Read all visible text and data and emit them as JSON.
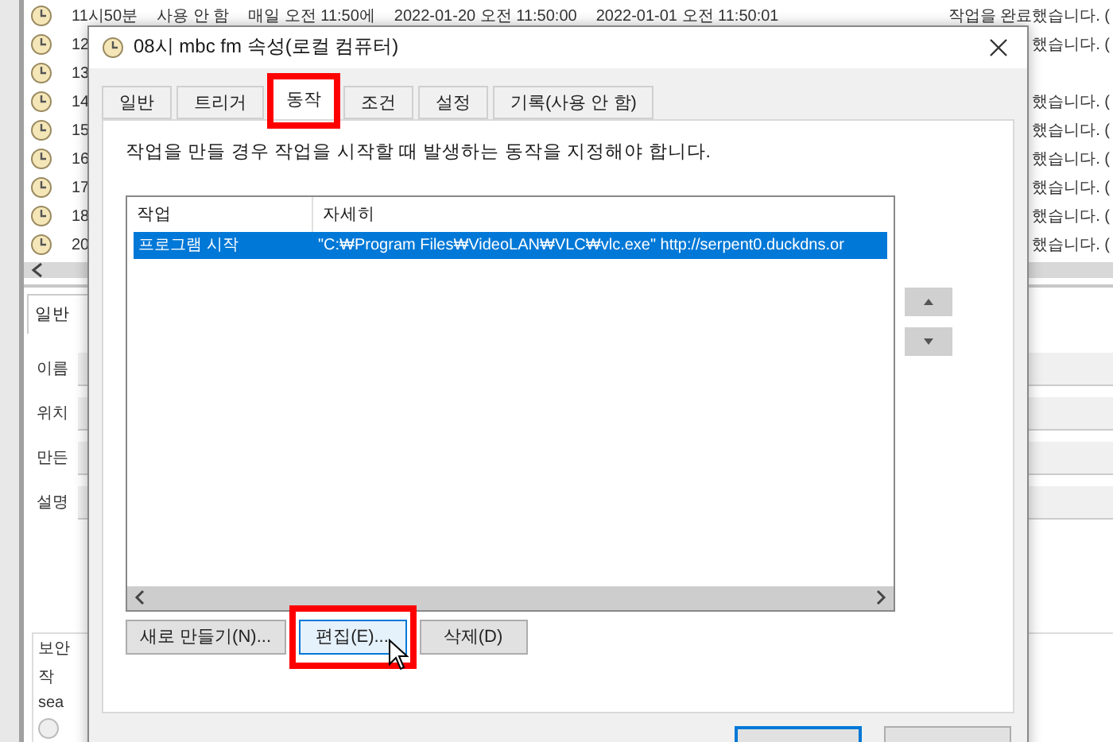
{
  "background": {
    "task_rows": [
      {
        "name": "11시50분",
        "status": "사용 안 함",
        "trigger": "매일 오전 11:50에",
        "next_run": "2022-01-20 오전 11:50:00",
        "last_run": "2022-01-01 오전 11:50:01",
        "result": "작업을 완료했습니다. ("
      },
      {
        "name": "12",
        "result": "했습니다. ("
      },
      {
        "name": "13"
      },
      {
        "name": "14",
        "result": "했습니다. ("
      },
      {
        "name": "15",
        "result": "했습니다. ("
      },
      {
        "name": "16",
        "result": "했습니다. ("
      },
      {
        "name": "17",
        "result": "했습니다. ("
      },
      {
        "name": "18",
        "result": "했습니다. ("
      },
      {
        "name": "20",
        "result": "했습니다. ("
      }
    ],
    "detail_tab": "일반",
    "fields": [
      "이름",
      "위치",
      "만든",
      "설명"
    ],
    "security_group": "보안",
    "security_label": "작",
    "account_value": "sea",
    "radio_checked": false
  },
  "dialog": {
    "title": "08시 mbc fm 속성(로컬 컴퓨터)",
    "tabs": [
      {
        "label": "일반",
        "selected": false,
        "highlighted": false
      },
      {
        "label": "트리거",
        "selected": false,
        "highlighted": false
      },
      {
        "label": "동작",
        "selected": true,
        "highlighted": true
      },
      {
        "label": "조건",
        "selected": false,
        "highlighted": false
      },
      {
        "label": "설정",
        "selected": false,
        "highlighted": false
      },
      {
        "label": "기록(사용 안 함)",
        "selected": false,
        "highlighted": false
      }
    ],
    "description": "작업을 만들 경우 작업을 시작할 때 발생하는 동작을 지정해야 합니다.",
    "columns": [
      "작업",
      "자세히"
    ],
    "rows": [
      {
        "cells": [
          "프로그램 시작",
          "\"C:₩Program Files₩VideoLAN₩VLC₩vlc.exe\" http://serpent0.duckdns.or"
        ],
        "selected": true
      }
    ],
    "buttons": [
      {
        "label": "새로 만들기(N)...",
        "hovered": false,
        "highlighted": false
      },
      {
        "label": "편집(E)...",
        "hovered": true,
        "highlighted": true
      },
      {
        "label": "삭제(D)",
        "hovered": false,
        "highlighted": false
      }
    ],
    "footer_buttons": [
      {
        "default": true
      },
      {
        "default": false
      }
    ]
  }
}
